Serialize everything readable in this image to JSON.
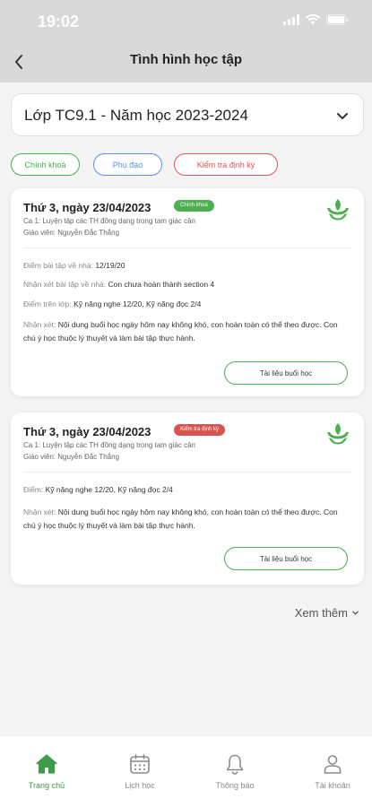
{
  "status_bar": {
    "time": "19:02"
  },
  "nav": {
    "title": "Tình hình học tập"
  },
  "class_select": {
    "value": "Lớp TC9.1 - Năm học 2023-2024"
  },
  "filters": [
    {
      "label": "Chính khoá",
      "color": "#4caf50"
    },
    {
      "label": "Phụ đạo",
      "color": "#5b8ff0"
    },
    {
      "label": "Kiểm tra định kỳ",
      "color": "#e05555"
    }
  ],
  "cards": [
    {
      "date": "Thứ 3, ngày 23/04/2023",
      "badge": "Chính khoá",
      "badge_color": "#4caf50",
      "lesson": "Ca 1: Luyện tập các TH đồng dạng trong tam giác cân",
      "teacher": "Giáo viên: Nguyễn Đắc Thắng",
      "rows": [
        {
          "label": "Điểm bài tập về nhà: ",
          "value": "12/19/20"
        },
        {
          "label": "Nhận xét bài tập về nhà: ",
          "value": "Con chưa hoàn thành section 4"
        },
        {
          "label": "Điểm trên lớp: ",
          "value": "Kỹ năng nghe 12/20, Kỹ năng đọc 2/4"
        },
        {
          "label": "Nhận xét: ",
          "value": "Nội dung buổi học ngày hôm nay không khó, con hoàn toàn có thể theo được. Con chú ý học thuộc lý thuyết và làm bài tập thực hành."
        }
      ],
      "button": "Tài liệu buổi học"
    },
    {
      "date": "Thứ 3, ngày 23/04/2023",
      "badge": "Kiểm tra định kỳ",
      "badge_color": "#d9534f",
      "lesson": "Ca 1: Luyện tập các TH đồng dạng trong tam giác cân",
      "teacher": "Giáo viên: Nguyễn Đắc Thắng",
      "rows": [
        {
          "label": "Điểm: ",
          "value": "Kỹ năng nghe 12/20, Kỹ năng đọc 2/4"
        },
        {
          "label": "Nhận xét: ",
          "value": "Nội dung buổi học ngày hôm nay không khó, con hoàn toàn có thể theo được. Con chú ý học thuộc lý thuyết và làm bài tập thực hành."
        }
      ],
      "button": "Tài liệu buổi học"
    }
  ],
  "see_more": "Xem thêm",
  "tabs": [
    {
      "label": "Trang chủ",
      "icon": "home-icon",
      "active": true
    },
    {
      "label": "Lịch học",
      "icon": "calendar-icon",
      "active": false
    },
    {
      "label": "Thông báo",
      "icon": "bell-icon",
      "active": false
    },
    {
      "label": "Tài khoản",
      "icon": "user-icon",
      "active": false
    }
  ],
  "colors": {
    "accent": "#4caf50",
    "header_bg": "#d9d9d9"
  }
}
